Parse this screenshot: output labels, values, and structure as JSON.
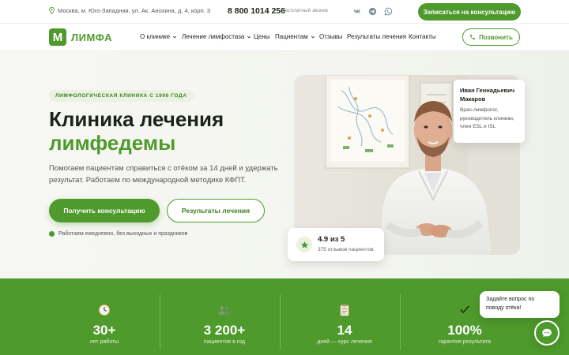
{
  "topbar": {
    "address": "Москва, м. Юго-Западная, ул. Ак. Анохина, д. 4, корп. 3",
    "phone": "8 800 1014 256",
    "phone_note": "бесплатный звонок",
    "cta": "Записаться на консультацию",
    "social_icons": [
      "vk-icon",
      "telegram-icon",
      "whatsapp-icon"
    ]
  },
  "brand": {
    "logo_letter": "M",
    "name": "ЛИМФА",
    "accent_color": "#4e9a2c"
  },
  "nav": {
    "items": [
      {
        "label": "О клинике",
        "dropdown": true
      },
      {
        "label": "Лечение лимфостаза",
        "dropdown": true
      },
      {
        "label": "Цены",
        "dropdown": false
      },
      {
        "label": "Пациентам",
        "dropdown": true
      },
      {
        "label": "Отзывы",
        "dropdown": false
      },
      {
        "label": "Результаты лечения",
        "dropdown": false
      },
      {
        "label": "Контакты",
        "dropdown": false
      }
    ],
    "call_button": "Позвонить"
  },
  "hero": {
    "eyebrow": "ЛИМФОЛОГИЧЕСКАЯ КЛИНИКА С 1996 ГОДА",
    "title_line1": "Клиника лечения",
    "title_line2": "лимфедемы",
    "lead": "Помогаем пациентам справиться с отёком за 14 дней и удержать результат. Работаем по международной методике КФПТ.",
    "primary_button": "Получить консультацию",
    "secondary_button": "Результаты лечения",
    "work_hours": "Работаем ежедневно, без выходных и праздников"
  },
  "doctor": {
    "name": "Иван Геннадьевич Макаров",
    "role": "Врач-лимфолог, руководитель клиники, член ESL и ISL"
  },
  "rating": {
    "value": "4.9 из 5",
    "reviews": "375 отзывов пациентов"
  },
  "stats": [
    {
      "icon": "clock-icon",
      "value": "30+",
      "label": "лет работы"
    },
    {
      "icon": "people-icon",
      "value": "3 200+",
      "label": "пациентов в год"
    },
    {
      "icon": "clipboard-icon",
      "value": "14",
      "label": "дней — курс лечения"
    },
    {
      "icon": "checkmark-icon",
      "value": "100%",
      "label": "гарантия результата"
    }
  ],
  "chat": {
    "bubble_text": "Задайте вопрос по поводу отёка!"
  }
}
